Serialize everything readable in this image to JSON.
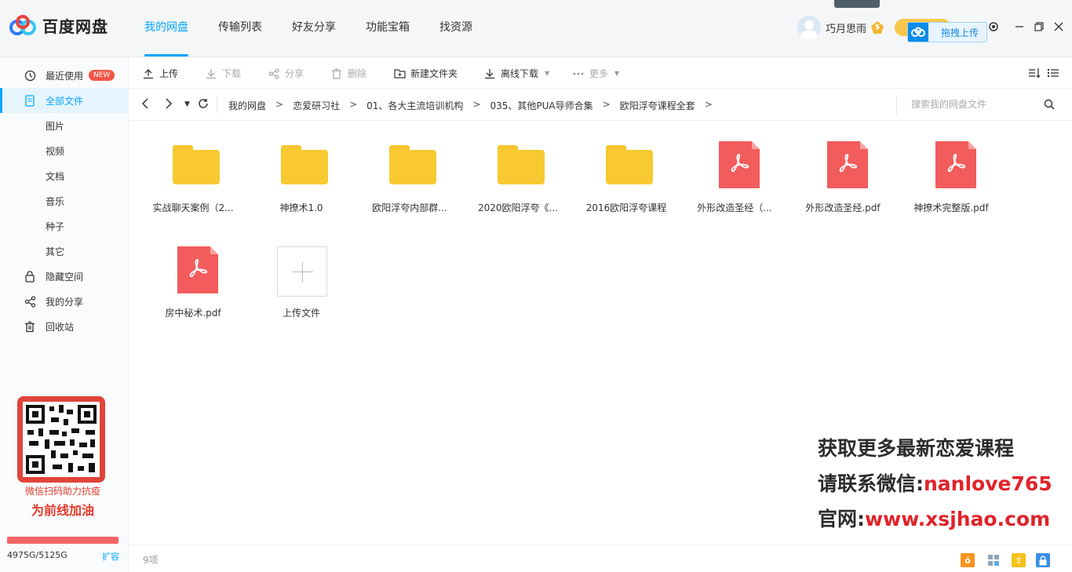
{
  "app": {
    "name": "百度网盘"
  },
  "nav": [
    {
      "label": "我的网盘"
    },
    {
      "label": "传输列表"
    },
    {
      "label": "好友分享"
    },
    {
      "label": "功能宝箱"
    },
    {
      "label": "找资源"
    }
  ],
  "user": {
    "name": "巧月思雨",
    "vip_icon": "vip-diamond-icon"
  },
  "drag_upload": {
    "label": "拖拽上传"
  },
  "sidebar": {
    "items": [
      {
        "label": "最近使用",
        "badge": "NEW",
        "icon": "clock-icon"
      },
      {
        "label": "全部文件",
        "icon": "document-icon"
      },
      {
        "label": "图片"
      },
      {
        "label": "视频"
      },
      {
        "label": "文档"
      },
      {
        "label": "音乐"
      },
      {
        "label": "种子"
      },
      {
        "label": "其它"
      },
      {
        "label": "隐藏空间",
        "icon": "lock-icon"
      },
      {
        "label": "我的分享",
        "icon": "share-icon"
      },
      {
        "label": "回收站",
        "icon": "trash-icon"
      }
    ],
    "promo_line1": "微信扫码助力抗疫",
    "promo_line2": "为前线加油",
    "quota_text": "4975G/5125G",
    "quota_used_fraction": 0.971,
    "expand_label": "扩容"
  },
  "toolbar": {
    "upload": "上传",
    "download": "下载",
    "share": "分享",
    "delete": "删除",
    "new_folder": "新建文件夹",
    "offline_download": "离线下载",
    "more": "更多"
  },
  "breadcrumb": [
    "我的网盘",
    "恋爱研习社",
    "01、各大主流培训机构",
    "035、其他PUA导师合集",
    "欧阳浮夸课程全套"
  ],
  "search": {
    "placeholder": "搜索我的网盘文件"
  },
  "files": [
    {
      "name": "实战聊天案例（2...",
      "type": "folder"
    },
    {
      "name": "神撩术1.0",
      "type": "folder"
    },
    {
      "name": "欧阳浮夸内部群...",
      "type": "folder"
    },
    {
      "name": "2020欧阳浮夸《...",
      "type": "folder"
    },
    {
      "name": "2016欧阳浮夸课程",
      "type": "folder"
    },
    {
      "name": "外形改造圣经（...",
      "type": "pdf"
    },
    {
      "name": "外形改造圣经.pdf",
      "type": "pdf"
    },
    {
      "name": "神撩术完整版.pdf",
      "type": "pdf"
    },
    {
      "name": "房中秘术.pdf",
      "type": "pdf"
    },
    {
      "name": "上传文件",
      "type": "upload"
    }
  ],
  "watermark": {
    "line1": "获取更多最新恋爱课程",
    "line2_prefix": "请联系微信:",
    "line2_value": "nanlove765",
    "line3_prefix": "官网:",
    "line3_value": "www.xsjhao.com"
  },
  "status": {
    "count": "9项"
  },
  "colors": {
    "accent": "#06a7ff",
    "folder": "#f8c930",
    "pdf": "#f25c5c",
    "watermark_red": "#e0232a"
  }
}
